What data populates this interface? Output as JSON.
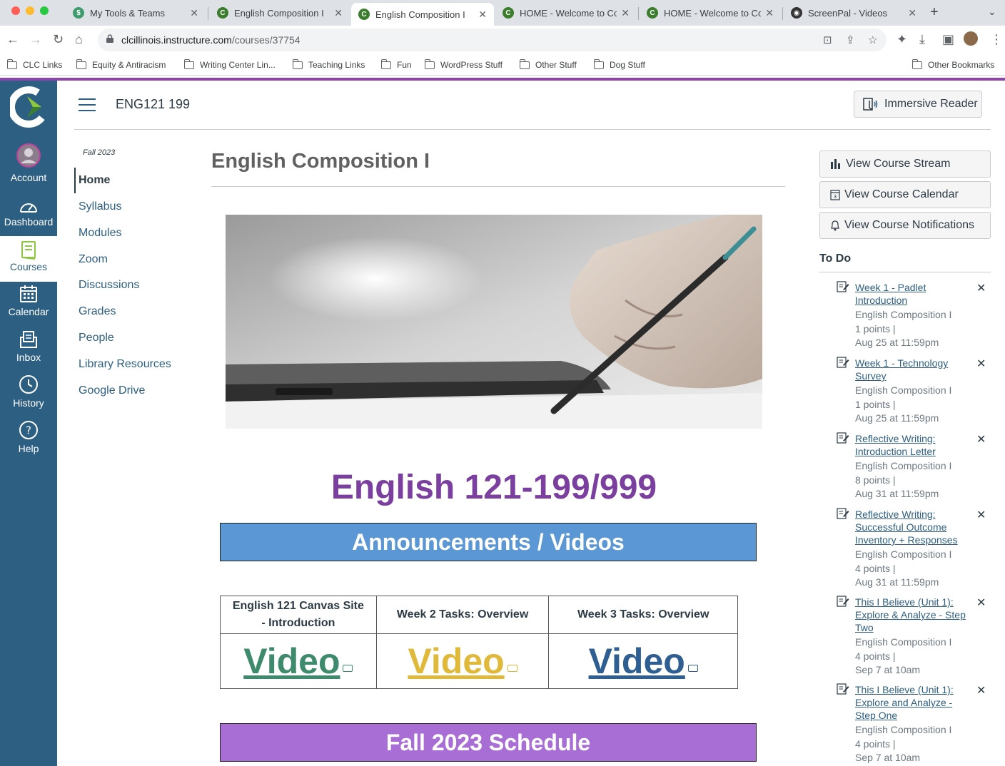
{
  "browser": {
    "tabs": [
      {
        "title": "My Tools & Teams"
      },
      {
        "title": "English Composition I"
      },
      {
        "title": "English Composition I"
      },
      {
        "title": "HOME - Welcome to Co"
      },
      {
        "title": "HOME - Welcome to Co"
      },
      {
        "title": "ScreenPal - Videos"
      }
    ],
    "url_host": "clcillinois.instructure.com",
    "url_path": "/courses/37754",
    "bookmarks": [
      "CLC Links",
      "Equity & Antiracism",
      "Writing Center Lin...",
      "Teaching Links",
      "Fun",
      "WordPress Stuff",
      "Other Stuff",
      "Dog Stuff"
    ],
    "other_bookmarks": "Other Bookmarks"
  },
  "global_nav": {
    "items": [
      {
        "label": "Account",
        "icon": "account-avatar-icon"
      },
      {
        "label": "Dashboard",
        "icon": "dashboard-gauge-icon"
      },
      {
        "label": "Courses",
        "icon": "courses-book-icon"
      },
      {
        "label": "Calendar",
        "icon": "calendar-icon"
      },
      {
        "label": "Inbox",
        "icon": "inbox-icon"
      },
      {
        "label": "History",
        "icon": "history-clock-icon"
      },
      {
        "label": "Help",
        "icon": "help-question-icon"
      }
    ]
  },
  "header": {
    "breadcrumb": "ENG121 199",
    "immersive_reader": "Immersive Reader"
  },
  "course_nav": {
    "term": "Fall 2023",
    "items": [
      "Home",
      "Syllabus",
      "Modules",
      "Zoom",
      "Discussions",
      "Grades",
      "People",
      "Library Resources",
      "Google Drive"
    ]
  },
  "content": {
    "page_title": "English Composition I",
    "big_heading": "English 121-199/999",
    "announcements_banner": "Announcements / Videos",
    "video_table": {
      "headers": [
        "English 121 Canvas Site - Introduction",
        "Week 2 Tasks: Overview",
        "Week 3 Tasks: Overview"
      ],
      "links": [
        "Video",
        "Video",
        "Video"
      ]
    },
    "schedule_banner": "Fall 2023 Schedule"
  },
  "sidebar": {
    "buttons": [
      "View Course Stream",
      "View Course Calendar",
      "View Course Notifications"
    ],
    "todo_heading": "To Do",
    "todo": [
      {
        "title": "Week 1 - Padlet Introduction",
        "course": "English Composition I",
        "points": "1 points  |",
        "due": "Aug 25 at 11:59pm"
      },
      {
        "title": "Week 1 - Technology Survey",
        "course": "English Composition I",
        "points": "1 points  |",
        "due": "Aug 25 at 11:59pm"
      },
      {
        "title": "Reflective Writing: Introduction Letter",
        "course": "English Composition I",
        "points": "8 points  |",
        "due": "Aug 31 at 11:59pm"
      },
      {
        "title": "Reflective Writing: Successful Outcome Inventory + Responses",
        "course": "English Composition I",
        "points": "4 points  |",
        "due": "Aug 31 at 11:59pm"
      },
      {
        "title": "This I Believe (Unit 1): Explore & Analyze - Step Two",
        "course": "English Composition I",
        "points": "4 points  |",
        "due": "Sep 7 at 10am"
      },
      {
        "title": "This I Believe (Unit 1): Explore and Analyze - Step One",
        "course": "English Composition I",
        "points": "4 points  |",
        "due": "Sep 7 at 10am"
      }
    ]
  },
  "colors": {
    "canvas_nav": "#2d5f82",
    "heading_purple": "#7b3fa0",
    "banner_blue": "#5b97d4",
    "banner_purple": "#a86ed6",
    "video_green": "#3d8a6c",
    "video_yellow": "#e0b83a",
    "video_blue": "#2f5f92"
  }
}
